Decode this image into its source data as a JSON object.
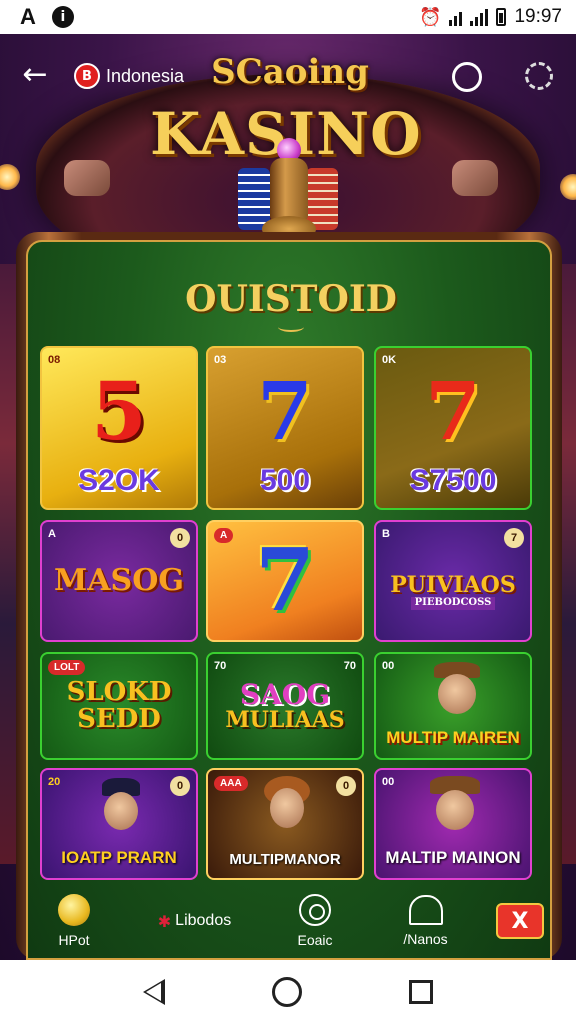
{
  "status_bar": {
    "left_letter": "A",
    "info_icon": "i",
    "time": "19:97",
    "icons": [
      "alarm-icon",
      "wifi-icon",
      "signal-icon",
      "battery-icon"
    ]
  },
  "header": {
    "region_flag": "B",
    "region_label": "Indonesia",
    "logo_top": "SCaoing",
    "logo_main": "KASINO"
  },
  "section": {
    "title": "OUISTOID"
  },
  "tiles": [
    {
      "badge": "08",
      "symbol": "5",
      "amount": "S2OK"
    },
    {
      "badge": "03",
      "symbol": "7",
      "amount": "500"
    },
    {
      "badge": "0K",
      "symbol": "7",
      "amount": "S7500"
    },
    {
      "badge": "A",
      "badge2": "0",
      "logo": "MASOG"
    },
    {
      "badge": "A",
      "symbol": "7"
    },
    {
      "badge": "B",
      "badge2": "7",
      "logo": "PUIVIAOS",
      "sublogo": "PIEBODCOSS"
    },
    {
      "badge": "LOLT",
      "logo": "SLOKD",
      "sublogo": "SEDD"
    },
    {
      "badge": "70",
      "badge2": "70",
      "logo": "SAOG",
      "sublogo": "MULIAAS"
    },
    {
      "badge": "00",
      "caption": "MULTIP MAIREN"
    },
    {
      "badge": "20",
      "badge2": "0",
      "caption": "IOATP PRARN"
    },
    {
      "badge": "AAA",
      "badge2": "0",
      "caption": "MULTIPMANOR"
    },
    {
      "badge": "00",
      "caption": "MALTIP MAINON"
    }
  ],
  "bottom_nav": {
    "items": [
      {
        "label": "HPot",
        "icon": "coin-icon"
      },
      {
        "label": "Libodos",
        "icon": "sparkle-icon"
      },
      {
        "label": "Eoaic",
        "icon": "ring-icon"
      },
      {
        "label": "/Nanos",
        "icon": "arch-icon"
      }
    ],
    "action": "X"
  },
  "colors": {
    "felt": "#1c5a1c",
    "gold": "#f2c440",
    "frame": "#5a2a12"
  }
}
